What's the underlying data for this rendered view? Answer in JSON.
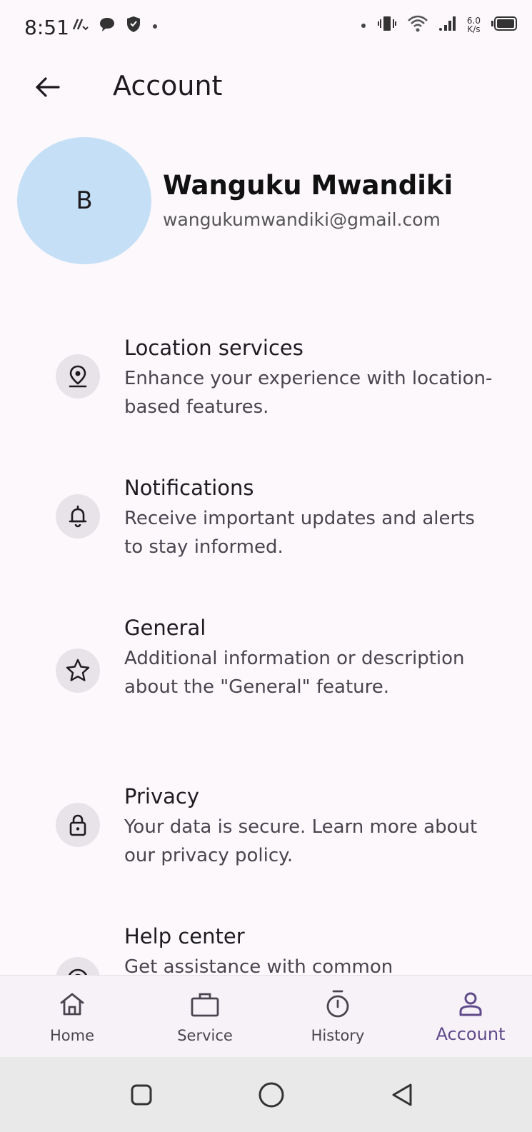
{
  "status_bar": {
    "time": "8:51",
    "speed_value": "6.0",
    "speed_unit": "K/s"
  },
  "header": {
    "title": "Account"
  },
  "profile": {
    "avatar_letter": "B",
    "name": "Wanguku Mwandiki",
    "email": "wangukumwandiki@gmail.com"
  },
  "menu": [
    {
      "icon": "location-pin-icon",
      "title": "Location services",
      "description": "Enhance your experience with location-based features."
    },
    {
      "icon": "bell-icon",
      "title": "Notifications",
      "description": "Receive important updates and alerts to stay informed."
    },
    {
      "icon": "star-icon",
      "title": "General",
      "description": "Additional information or description about the \"General\" feature."
    },
    {
      "icon": "lock-icon",
      "title": "Privacy",
      "description": "Your data is secure. Learn more about our privacy policy."
    },
    {
      "icon": "help-icon",
      "title": "Help center",
      "description": "Get assistance with common"
    }
  ],
  "bottom_nav": [
    {
      "label": "Home",
      "icon": "home-icon",
      "active": false
    },
    {
      "label": "Service",
      "icon": "briefcase-icon",
      "active": false
    },
    {
      "label": "History",
      "icon": "timer-icon",
      "active": false
    },
    {
      "label": "Account",
      "icon": "person-icon",
      "active": true
    }
  ],
  "colors": {
    "accent": "#5f4b8b",
    "avatar_bg": "#c5e0f6",
    "background": "#fcf8fc",
    "icon_bg": "#e7e3e8"
  }
}
